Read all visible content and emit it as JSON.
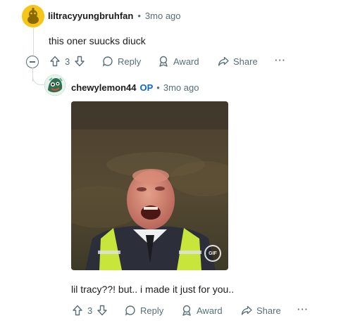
{
  "comment1": {
    "username": "liltracyyungbruhfan",
    "separator": "•",
    "time": "3mo ago",
    "text": "this oner suucks diuck",
    "votes": "3",
    "reply_label": "Reply",
    "award_label": "Award",
    "share_label": "Share",
    "more_label": "···"
  },
  "comment2": {
    "username": "chewylemon44",
    "op_badge": "OP",
    "separator": "•",
    "time": "3mo ago",
    "gif_badge": "GIF",
    "text": "lil tracy??! but.. i made it just for you..",
    "votes": "3",
    "reply_label": "Reply",
    "award_label": "Award",
    "share_label": "Share",
    "more_label": "···"
  },
  "colors": {
    "meta": "#576f76",
    "op": "#0a66d8",
    "avatar1_bg": "#f5c518",
    "avatar2_bg": "#2f6f4e"
  }
}
